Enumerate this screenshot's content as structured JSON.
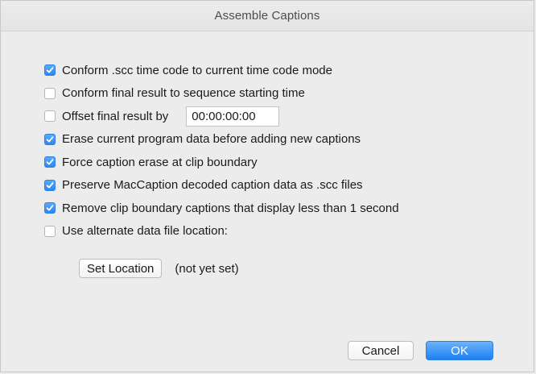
{
  "window": {
    "title": "Assemble Captions"
  },
  "options": [
    {
      "label": "Conform .scc time code to current time code mode",
      "checked": true
    },
    {
      "label": "Conform final result to sequence starting time",
      "checked": false
    },
    {
      "label": "Offset final result by",
      "checked": false
    },
    {
      "label": "Erase current program data before adding new captions",
      "checked": true
    },
    {
      "label": "Force caption erase at clip boundary",
      "checked": true
    },
    {
      "label": "Preserve MacCaption decoded caption data as .scc files",
      "checked": true
    },
    {
      "label": "Remove clip boundary captions that display less than 1 second",
      "checked": true
    },
    {
      "label": "Use alternate data file location:",
      "checked": false
    }
  ],
  "offset": {
    "value": "00:00:00:00"
  },
  "location": {
    "button_label": "Set Location",
    "status": "(not yet set)"
  },
  "footer": {
    "cancel_label": "Cancel",
    "ok_label": "OK"
  },
  "colors": {
    "accent": "#2e87f0",
    "background": "#ececec"
  }
}
